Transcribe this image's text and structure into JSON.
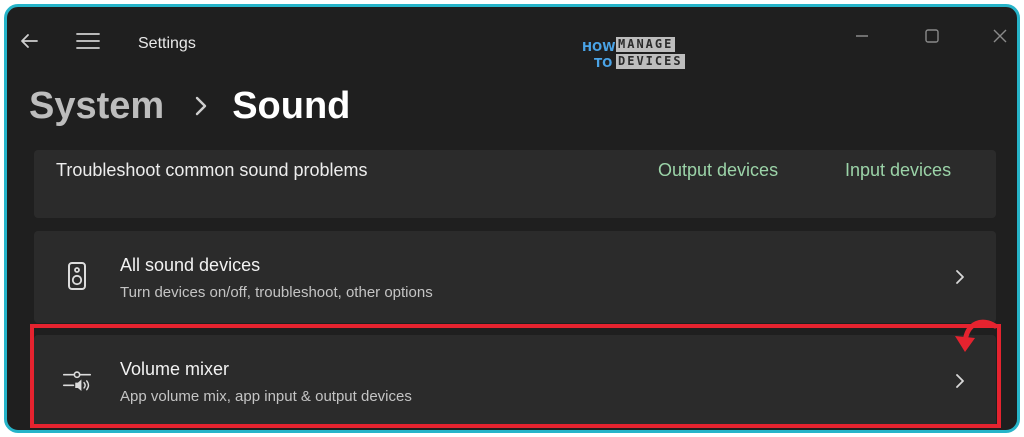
{
  "window": {
    "title": "Settings",
    "back_icon": "back-arrow-icon",
    "menu_icon": "hamburger-menu-icon",
    "controls": [
      "minimize-icon",
      "maximize-icon",
      "close-icon"
    ]
  },
  "watermark": {
    "how": "HOW",
    "to": "TO",
    "manage": "MANAGE",
    "devices": "DEVICES"
  },
  "breadcrumb": {
    "parent": "System",
    "separator_icon": "chevron-right-icon",
    "current": "Sound"
  },
  "troubleshoot": {
    "label": "Troubleshoot common sound problems",
    "links": [
      "Output devices",
      "Input devices"
    ]
  },
  "rows": [
    {
      "title": "All sound devices",
      "subtitle": "Turn devices on/off, troubleshoot, other options",
      "icon": "speaker-icon"
    },
    {
      "title": "Volume mixer",
      "subtitle": "App volume mix, app input & output devices",
      "icon": "volume-mixer-icon"
    }
  ],
  "colors": {
    "window_bg": "#1f1f1f",
    "card_bg": "#2b2b2b",
    "link": "#9bd3a8",
    "highlight": "#e5232f",
    "frame_border": "#26b4c9"
  }
}
